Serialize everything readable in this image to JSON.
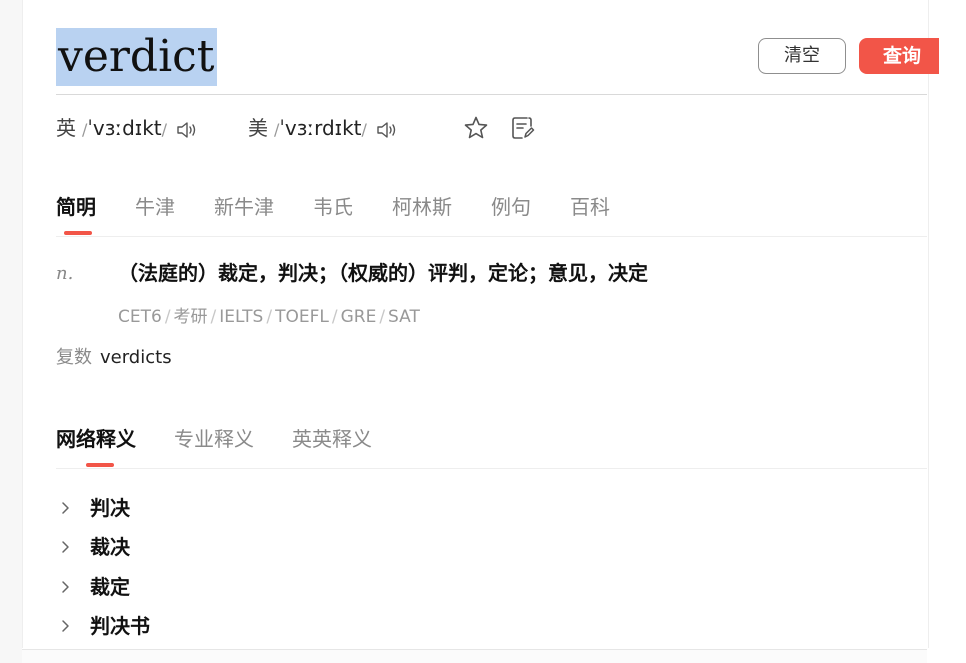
{
  "search": {
    "query": "verdict",
    "clear_label": "清空",
    "search_label": "查询"
  },
  "phonetics": {
    "uk": {
      "region": "英",
      "ipa": "ˈvɜːdɪkt"
    },
    "us": {
      "region": "美",
      "ipa": "ˈvɜːrdɪkt"
    }
  },
  "dict_tabs": [
    "简明",
    "牛津",
    "新牛津",
    "韦氏",
    "柯林斯",
    "例句",
    "百科"
  ],
  "definition": {
    "pos": "n.",
    "text": "（法庭的）裁定，判决；（权威的）评判，定论；意见，决定",
    "exam_tags": [
      "CET6",
      "考研",
      "IELTS",
      "TOEFL",
      "GRE",
      "SAT"
    ],
    "plural_label": "复数",
    "plural_value": "verdicts"
  },
  "meaning_tabs": [
    "网络释义",
    "专业释义",
    "英英释义"
  ],
  "net_meanings": [
    "判决",
    "裁决",
    "裁定",
    "判决书"
  ],
  "colors": {
    "accent": "#f25548",
    "selection": "#b9d2f1"
  }
}
